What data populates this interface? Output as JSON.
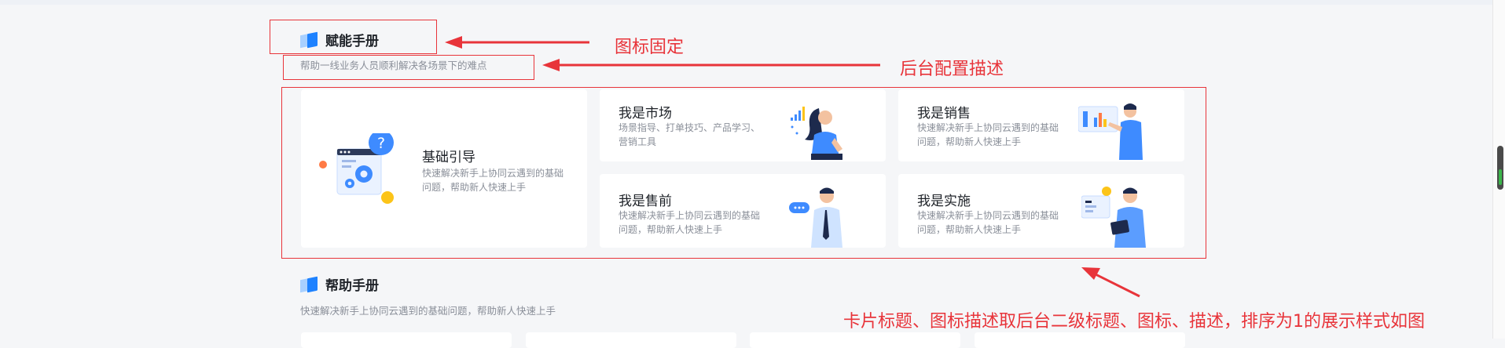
{
  "section1": {
    "title": "赋能手册",
    "description": "帮助一线业务人员顺利解决各场景下的难点",
    "icon": "book-icon"
  },
  "main_card": {
    "title": "基础引导",
    "description": "快速解决新手上协同云遇到的基础问题，帮助新人快速上手",
    "icon": "gear-help-icon"
  },
  "cards": [
    {
      "title": "我是市场",
      "description": "场景指导、打单技巧、产品学习、营销工具",
      "illustration": "woman-chart-illustration"
    },
    {
      "title": "我是销售",
      "description": "快速解决新手上协同云遇到的基础问题，帮助新人快速上手",
      "illustration": "man-dashboard-illustration"
    },
    {
      "title": "我是售前",
      "description": "快速解决新手上协同云遇到的基础问题，帮助新人快速上手",
      "illustration": "man-speaking-illustration"
    },
    {
      "title": "我是实施",
      "description": "快速解决新手上协同云遇到的基础问题，帮助新人快速上手",
      "illustration": "man-tablet-illustration"
    }
  ],
  "section2": {
    "title": "帮助手册",
    "description": "快速解决新手上协同云遇到的基础问题，帮助新人快速上手",
    "icon": "book-icon"
  },
  "annotations": {
    "icon_fixed": "图标固定",
    "backend_desc": "后台配置描述",
    "card_note": "卡片标题、图标描述取后台二级标题、图标、描述，排序为1的展示样式如图"
  },
  "colors": {
    "annotation": "#e8343a",
    "accent": "#1e82ff",
    "background": "#f5f6f8"
  }
}
